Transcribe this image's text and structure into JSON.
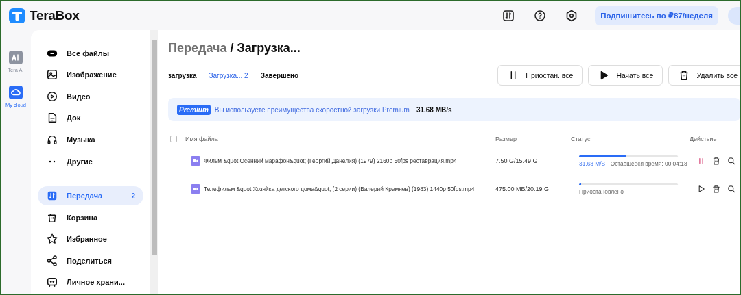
{
  "app": {
    "name": "TeraBox"
  },
  "header": {
    "subscribe_button": "Подпишитесь по ₽87/неделя"
  },
  "rail": [
    {
      "label": "Tera AI",
      "kind": "ai",
      "selected": false
    },
    {
      "label": "My cloud",
      "kind": "cloud",
      "selected": true
    }
  ],
  "sidebar": {
    "groups": [
      [
        {
          "label": "Все файлы",
          "kind": "all",
          "selected": false
        },
        {
          "label": "Изображение",
          "kind": "image",
          "selected": false
        },
        {
          "label": "Видео",
          "kind": "video",
          "selected": false
        },
        {
          "label": "Док",
          "kind": "doc",
          "selected": false
        },
        {
          "label": "Музыка",
          "kind": "music",
          "selected": false
        },
        {
          "label": "Другие",
          "kind": "other",
          "selected": false
        }
      ],
      [
        {
          "label": "Передача",
          "kind": "transfer",
          "selected": true,
          "count": "2"
        },
        {
          "label": "Корзина",
          "kind": "trash",
          "selected": false
        },
        {
          "label": "Избранное",
          "kind": "star",
          "selected": false
        },
        {
          "label": "Поделиться",
          "kind": "share",
          "selected": false
        },
        {
          "label": "Личное храни...",
          "kind": "vault",
          "selected": false
        }
      ]
    ]
  },
  "breadcrumb": {
    "items": [
      "Передача",
      "Загрузка..."
    ],
    "separator": "/"
  },
  "tabs": [
    {
      "label": "загрузка",
      "selected": false
    },
    {
      "label": "Загрузка... 2",
      "selected": true
    },
    {
      "label": "Завершено",
      "selected": false
    }
  ],
  "actions": [
    {
      "label": "Приостан. все",
      "kind": "pause"
    },
    {
      "label": "Начать все",
      "kind": "play"
    },
    {
      "label": "Удалить все",
      "kind": "trash"
    }
  ],
  "banner": {
    "badge": "Premium",
    "message": "Вы используете преимущества скоростной загрузки Premium",
    "speed": "31.68 MB/s"
  },
  "table": {
    "select_all": false,
    "columns": [
      "Имя файла",
      "Размер",
      "Статус",
      "Действие"
    ],
    "rows": [
      {
        "name": "Фильм &quot;Осенний марафон&quot; (Георгий Данелия) (1979) 2160p 50fps реставрация.mp4",
        "size": "7.50 G/15.49 G",
        "kind": "downloading",
        "level": 0.48,
        "speed": "31.68 M/S",
        "status": " - Оставшееся время: 00:04:18"
      },
      {
        "name": "Телефильм &quot;Хозяйка детского дома&quot; (2 серии) (Валерий Кремнев) (1983) 1440p 50fps.mp4",
        "size": "475.00 MB/20.19 G",
        "kind": "paused",
        "level": 0.02,
        "status": "Приостановлено"
      }
    ]
  }
}
